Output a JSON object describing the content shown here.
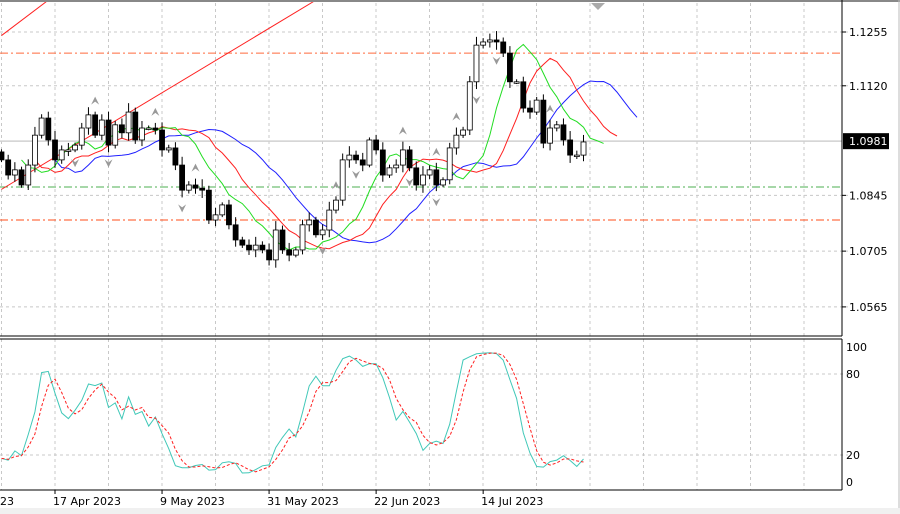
{
  "chart_data": {
    "type": "candlestick",
    "symbol_hint": "",
    "price_axis": {
      "ticks": [
        "1.1255",
        "1.1120",
        "1.0845",
        "1.0705",
        "1.0565"
      ],
      "range": [
        1.052,
        1.1335
      ]
    },
    "current_price": {
      "label": "1.0981",
      "value": 1.0981
    },
    "date_labels": [
      {
        "text": "23",
        "index": -16
      },
      {
        "text": "17 Apr 2023",
        "index": 0
      },
      {
        "text": "9 May 2023",
        "index": 16
      },
      {
        "text": "31 May 2023",
        "index": 32
      },
      {
        "text": "22 Jun 2023",
        "index": 48
      },
      {
        "text": "14 Jul 2023",
        "index": 64
      }
    ],
    "first_index": -8,
    "closes": [
      1.0934,
      1.0896,
      1.0909,
      1.0871,
      1.0921,
      1.0996,
      1.1039,
      1.0984,
      1.0934,
      1.0959,
      1.0959,
      1.0971,
      1.1014,
      1.1047,
      1.0996,
      1.1034,
      1.0971,
      1.1022,
      1.1002,
      1.1054,
      1.0984,
      1.1014,
      1.1014,
      1.1009,
      1.0959,
      1.0964,
      1.0921,
      1.0858,
      1.0871,
      1.0863,
      1.0858,
      1.0783,
      1.0796,
      1.0821,
      1.0771,
      1.0733,
      1.072,
      1.0708,
      1.072,
      1.0708,
      1.0683,
      1.0758,
      1.0708,
      1.0695,
      1.0708,
      1.0771,
      1.0783,
      1.0746,
      1.0758,
      1.0808,
      1.0833,
      1.0934,
      1.0946,
      1.0934,
      1.0921,
      1.0984,
      1.0959,
      1.0896,
      1.0914,
      1.0921,
      1.0959,
      1.0914,
      1.0871,
      1.0896,
      1.0909,
      1.0871,
      1.0884,
      1.0964,
      1.0996,
      1.1009,
      1.113,
      1.1222,
      1.123,
      1.1235,
      1.123,
      1.1202,
      1.113,
      1.113,
      1.1064,
      1.1054,
      1.1084,
      1.0976,
      1.1014,
      1.1022,
      1.0984,
      1.0946,
      1.0946,
      1.0979
    ],
    "horizontal_levels": [
      {
        "value": 1.1202,
        "color": "#ff6a3c",
        "style": "dash-dot"
      },
      {
        "value": 1.0866,
        "color": "#4caf50",
        "style": "dash-dot"
      },
      {
        "value": 1.0783,
        "color": "#ff4d1a",
        "style": "dash-dot"
      }
    ],
    "trendlines": [
      {
        "from": [
          -8,
          1.086
        ],
        "to": [
          39,
          1.1335
        ],
        "color": "#ff2020"
      },
      {
        "from": [
          -8,
          1.1246
        ],
        "to": [
          -1,
          1.1335
        ],
        "color": "#ff2020"
      }
    ],
    "indicators": {
      "alligator": {
        "jaw": {
          "period": 13,
          "shift": 8,
          "color": "#2020ff"
        },
        "teeth": {
          "period": 8,
          "shift": 5,
          "color": "#ff2020"
        },
        "lips": {
          "period": 5,
          "shift": 3,
          "color": "#22dd22"
        }
      },
      "stochastic": {
        "levels": [
          "100",
          "80",
          "20",
          "0"
        ],
        "k_color": "#40c8b8",
        "d_color": "#ff2020"
      }
    },
    "fractals_up": [
      6,
      15,
      21,
      42,
      52,
      57,
      60,
      74,
      81
    ],
    "fractals_down": [
      3,
      8,
      19,
      40,
      45,
      53,
      57,
      63,
      66,
      82
    ],
    "colors": {
      "bull": "#ffffff",
      "bear": "#000000",
      "grid": "#c8c8c8"
    }
  }
}
